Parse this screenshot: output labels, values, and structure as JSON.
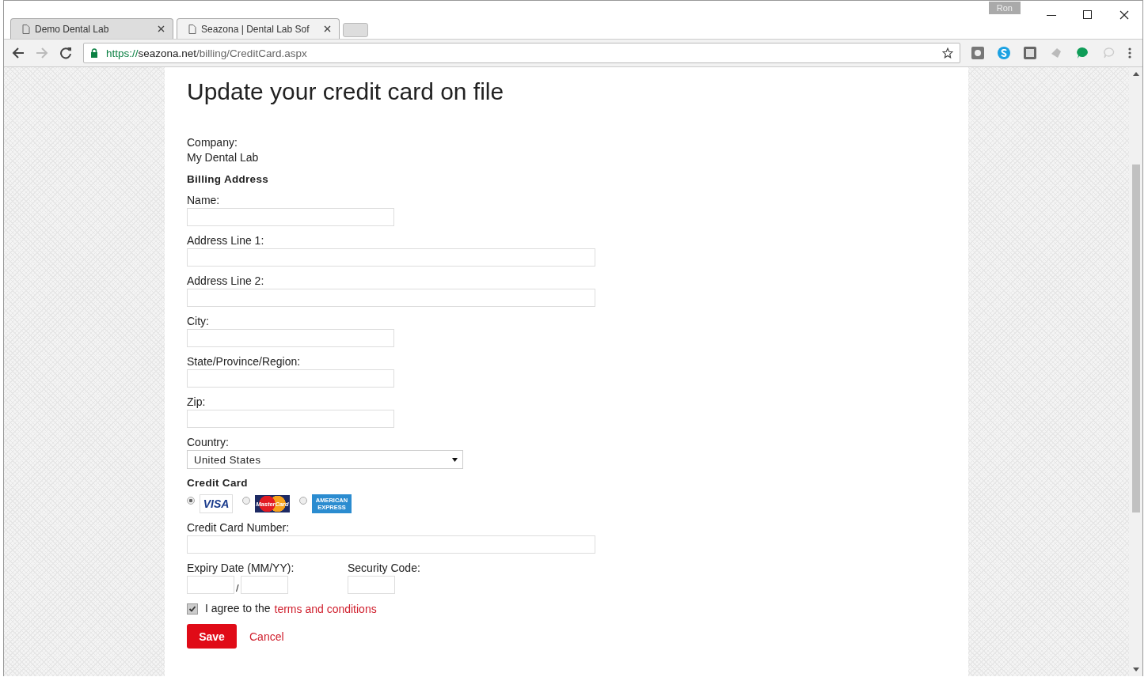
{
  "window": {
    "user": "Ron"
  },
  "tabs": [
    {
      "title": "Demo Dental Lab",
      "selected": false
    },
    {
      "title": "Seazona | Dental Lab Sof",
      "selected": true
    }
  ],
  "address_bar": {
    "scheme": "https://",
    "host": "seazona.net",
    "path": "/billing/CreditCard.aspx",
    "secure": true
  },
  "page": {
    "title": "Update your credit card on file",
    "company_label": "Company:",
    "company": "My Dental Lab",
    "billing_heading": "Billing Address",
    "fields": [
      {
        "label": "Name:",
        "wide": false
      },
      {
        "label": "Address Line 1:",
        "wide": true
      },
      {
        "label": "Address Line 2:",
        "wide": true
      },
      {
        "label": "City:",
        "wide": false
      },
      {
        "label": "State/Province/Region:",
        "wide": false
      },
      {
        "label": "Zip:",
        "wide": false
      }
    ],
    "country_label": "Country:",
    "country": "United States",
    "card_heading": "Credit Card",
    "card_types": [
      {
        "kind": "visa",
        "text": "VISA",
        "selected": true
      },
      {
        "kind": "mastercard",
        "text": "MasterCard",
        "selected": false
      },
      {
        "kind": "amex",
        "text": "AMERICAN EXPRESS",
        "selected": false
      }
    ],
    "card_number_label": "Credit Card Number:",
    "expiry_label": "Expiry Date (MM/YY):",
    "expiry_separator": "/",
    "security_label": "Security Code:",
    "agree": {
      "checked": true,
      "text": "I agree to the",
      "link": "terms and conditions"
    },
    "save": "Save",
    "cancel": "Cancel"
  }
}
